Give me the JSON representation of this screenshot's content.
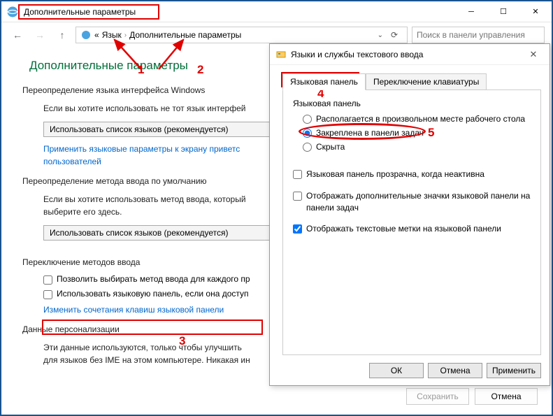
{
  "window": {
    "title": "Дополнительные параметры"
  },
  "breadcrumb": {
    "item1": "Язык",
    "item2": "Дополнительные параметры"
  },
  "search": {
    "placeholder": "Поиск в панели управления"
  },
  "page_title": "Дополнительные параметры",
  "sec1": {
    "heading": "Переопределение языка интерфейса Windows",
    "body": "Если вы хотите использовать не тот язык интерфей",
    "combo": "Использовать список языков (рекомендуется)",
    "link": "Применить языковые параметры к экрану приветс\nпользователей"
  },
  "sec2": {
    "heading": "Переопределение метода ввода по умолчанию",
    "body": "Если вы хотите использовать метод ввода, который\nвыберите его здесь.",
    "combo": "Использовать список языков (рекомендуется)"
  },
  "sec3": {
    "heading": "Переключение методов ввода",
    "cb1": "Позволить выбирать метод ввода для каждого пр",
    "cb2": "Использовать языковую панель, если она доступ",
    "link": "Изменить сочетания клавиш языковой панели"
  },
  "sec4": {
    "heading": "Данные персонализации",
    "body": "Эти данные используются, только чтобы улучшить\nдля языков без IME на этом компьютере. Никакая ин"
  },
  "main_buttons": {
    "save": "Сохранить",
    "cancel": "Отмена"
  },
  "dialog": {
    "title": "Языки и службы текстового ввода",
    "tab_active": "Языковая панель",
    "tab_other": "Переключение клавиатуры",
    "group_title": "Языковая панель",
    "radio1": "Располагается в произвольном месте рабочего стола",
    "radio2": "Закреплена в панели задач",
    "radio3": "Скрыта",
    "cb1": "Языковая панель прозрачна, когда неактивна",
    "cb2": "Отображать дополнительные значки языковой панели на панели задач",
    "cb3": "Отображать текстовые метки на языковой панели",
    "ok": "ОК",
    "cancel": "Отмена",
    "apply": "Применить"
  },
  "annotations": {
    "n1": "1",
    "n2": "2",
    "n3": "3",
    "n4": "4",
    "n5": "5"
  }
}
